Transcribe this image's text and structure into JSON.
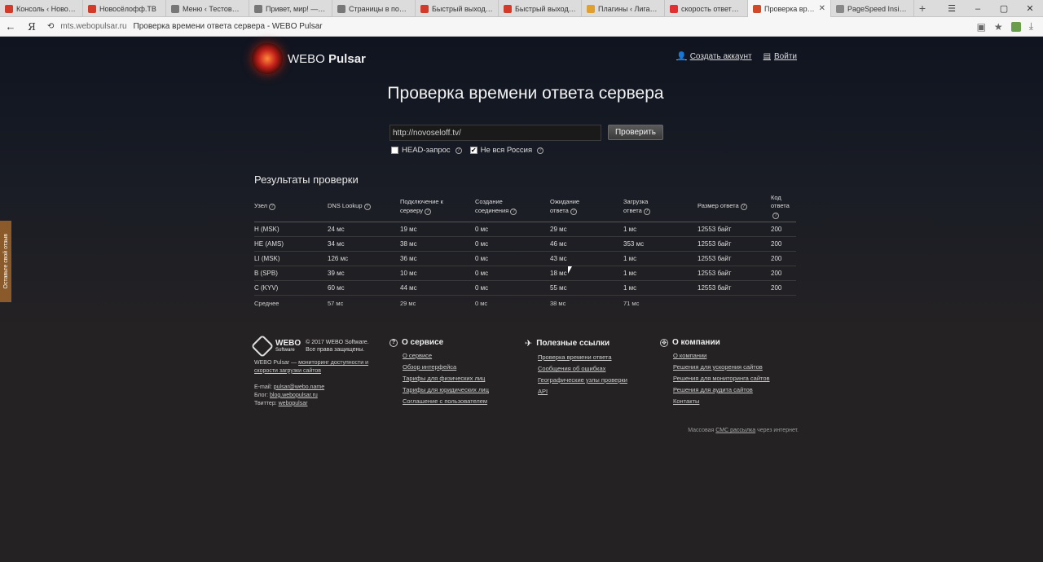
{
  "browser": {
    "tabs": [
      {
        "label": "Консоль ‹ Новосё…",
        "color": "#d23a2a"
      },
      {
        "label": "Новосёлофф.ТВ",
        "color": "#d23a2a"
      },
      {
        "label": "Меню ‹ Тестовый с…",
        "color": "#777"
      },
      {
        "label": "Привет, мир! — Те…",
        "color": "#777"
      },
      {
        "label": "Страницы в поиск…",
        "color": "#777"
      },
      {
        "label": "Быстрый выход на…",
        "color": "#d23a2a"
      },
      {
        "label": "Быстрый выход на…",
        "color": "#d23a2a"
      },
      {
        "label": "Плагины ‹ Лига-Т…",
        "color": "#e0a030"
      },
      {
        "label": "скорость ответа се…",
        "color": "#e03030"
      },
      {
        "label": "Проверка време…",
        "color": "#d04a2a",
        "active": true
      },
      {
        "label": "PageSpeed Insights",
        "color": "#888"
      }
    ],
    "new_tab": "+",
    "address_host": "mts.webopulsar.ru",
    "address_title": "Проверка времени ответа сервера - WEBO Pulsar",
    "back": "←",
    "yandex": "Я"
  },
  "header": {
    "logo_text_a": "WEBO",
    "logo_text_b": "Pulsar",
    "create_account": "Создать аккаунт",
    "login": "Войти"
  },
  "title": "Проверка времени ответа сервера",
  "form": {
    "url_value": "http://novoseloff.tv/",
    "check_label": "Проверить",
    "head_request": "HEAD-запрос",
    "not_all_russia": "Не вся Россия"
  },
  "results": {
    "title": "Результаты проверки",
    "headers": [
      [
        "Узел"
      ],
      [
        "DNS Lookup"
      ],
      [
        "Подключение к",
        "серверу"
      ],
      [
        "Создание",
        "соединения"
      ],
      [
        "Ожидание",
        "ответа"
      ],
      [
        "Загрузка",
        "ответа"
      ],
      [
        "Размер ответа"
      ],
      [
        "Код",
        "ответа"
      ]
    ],
    "rows": [
      [
        "H (MSK)",
        "24 мс",
        "19 мс",
        "0 мс",
        "29 мс",
        "1 мс",
        "12553 байт",
        "200"
      ],
      [
        "HE (AMS)",
        "34 мс",
        "38 мс",
        "0 мс",
        "46 мс",
        "353 мс",
        "12553 байт",
        "200"
      ],
      [
        "LI (MSK)",
        "126 мс",
        "36 мс",
        "0 мс",
        "43 мс",
        "1 мс",
        "12553 байт",
        "200"
      ],
      [
        "B (SPB)",
        "39 мс",
        "10 мс",
        "0 мс",
        "18 мс",
        "1 мс",
        "12553 байт",
        "200"
      ],
      [
        "C (KYV)",
        "60 мс",
        "44 мс",
        "0 мс",
        "55 мс",
        "1 мс",
        "12553 байт",
        "200"
      ]
    ],
    "average": [
      "Среднее",
      "57 мс",
      "29 мс",
      "0 мс",
      "38 мс",
      "71 мс",
      "",
      ""
    ]
  },
  "feedback": "Оставьте свой отзыв",
  "footer": {
    "brand_name": "WEBO",
    "brand_sub": "Software",
    "copyright": "© 2017 WEBO Software.",
    "rights": "Все права защищены.",
    "desc_prefix": "WEBO Pulsar —",
    "desc_link": "мониторинг доступности и скорости загрузки сайтов",
    "email_label": "E-mail:",
    "email": "pulsar@webo.name",
    "blog_label": "Блог:",
    "blog": "blog.webopulsar.ru",
    "twitter_label": "Твиттер:",
    "twitter": "webopulsar",
    "col_service": {
      "title": "О сервисе",
      "links": [
        "О сервисе",
        "Обзор интерфейса",
        "Тарифы для физических лиц",
        "Тарифы для юридических лиц",
        "Соглашение с пользователем"
      ]
    },
    "col_links": {
      "title": "Полезные ссылки",
      "links": [
        "Проверка времени ответа",
        "Сообщения об ошибках",
        "Географические узлы проверки",
        "API"
      ]
    },
    "col_company": {
      "title": "О компании",
      "links": [
        "О компании",
        "Решения для ускорения сайтов",
        "Решения для мониторинга сайтов",
        "Решения для аудита сайтов",
        "Контакты"
      ]
    },
    "sms_prefix": "Массовая",
    "sms_link": "СМС рассылка",
    "sms_suffix": "через интернет."
  }
}
